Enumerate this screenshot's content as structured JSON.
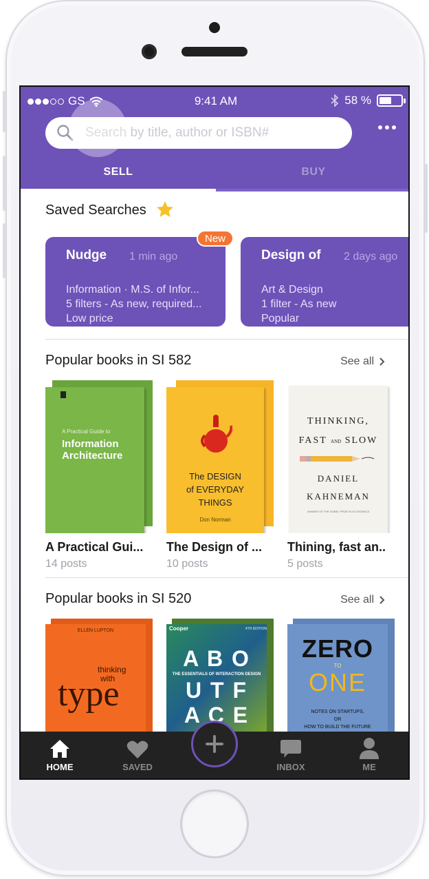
{
  "status_bar": {
    "carrier": "GS",
    "time": "9:41 AM",
    "battery": "58 %",
    "battery_level": 0.58,
    "signal_bars": 3
  },
  "search": {
    "placeholder": "Search by title, author or ISBN#"
  },
  "tabs": [
    {
      "label": "SELL",
      "active": true
    },
    {
      "label": "BUY",
      "active": false
    }
  ],
  "saved_searches": {
    "title": "Saved Searches",
    "badge": "New",
    "items": [
      {
        "title": "Nudge",
        "time": "1 min ago",
        "line1": "Information · M.S. of Infor...",
        "line2": "5 filters - As new, required...",
        "line3": "Low price"
      },
      {
        "title": "Design of",
        "time": "2 days ago",
        "line1": "Art & Design",
        "line2": "1 filter - As new",
        "line3": "Popular"
      }
    ]
  },
  "section_582": {
    "title": "Popular books in SI 582",
    "see_all": "See all",
    "books": [
      {
        "title": "A Practical Gui...",
        "posts": "14 posts",
        "cover_subtitle": "A Practical Guide to",
        "cover_title": "Information Architecture",
        "color": "#7ab648"
      },
      {
        "title": "The Design of ...",
        "posts": "10 posts",
        "cover_title_a": "The DESIGN",
        "cover_title_b": "of EVERYDAY",
        "cover_title_c": "THINGS",
        "cover_author": "Don Norman",
        "color": "#f6b927"
      },
      {
        "title": "Thining, fast an..",
        "posts": "5 posts",
        "cover_line1": "THINKING,",
        "cover_line2": "FAST",
        "cover_and": "AND",
        "cover_line3": "SLOW",
        "cover_author1": "DANIEL",
        "cover_author2": "KAHNEMAN",
        "cover_note": "WINNER OF THE NOBEL PRIZE IN ECONOMICS",
        "color": "#f3f1ec"
      }
    ]
  },
  "section_520": {
    "title": "Popular books in SI 520",
    "see_all": "See all",
    "books": [
      {
        "cover_author": "ELLEN LUPTON",
        "cover_top": "thinking",
        "cover_mid": "with",
        "cover_big": "type",
        "color": "#f26a21"
      },
      {
        "cover_brand": "Cooper",
        "cover_tag": "4TH EDITION",
        "cover_row1": "A B O",
        "cover_sub": "THE ESSENTIALS OF INTERACTION DESIGN",
        "cover_row2": "U T F",
        "cover_row3": "A C E",
        "color": "#2f6e3a"
      },
      {
        "cover_big1": "ZERO",
        "cover_to": "TO",
        "cover_big2": "ONE",
        "cover_note1": "NOTES ON STARTUPS,",
        "cover_or": "OR",
        "cover_note2": "HOW TO BUILD THE FUTURE",
        "color": "#6f94c9"
      }
    ]
  },
  "bottom_nav": [
    {
      "label": "HOME",
      "icon": "home-icon",
      "active": true
    },
    {
      "label": "SAVED",
      "icon": "heart-icon",
      "active": false
    },
    {
      "label": "",
      "icon": "plus-icon",
      "active": false
    },
    {
      "label": "INBOX",
      "icon": "chat-icon",
      "active": false
    },
    {
      "label": "ME",
      "icon": "person-icon",
      "active": false
    }
  ],
  "colors": {
    "primary": "#6d52b8",
    "badge": "#f47533",
    "tabbar": "#222222"
  }
}
